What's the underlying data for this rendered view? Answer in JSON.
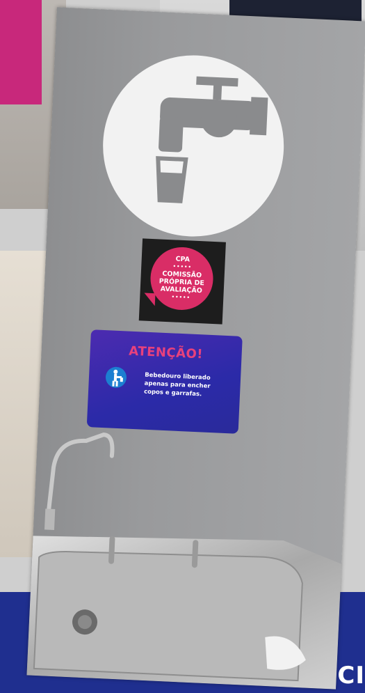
{
  "background": {
    "top_right_card_text": "",
    "bottom_band_text": "SOCI",
    "bottom_band_color": "#1f2f8f"
  },
  "sign_water": {
    "icon": "faucet-and-cup-icon",
    "circle_color": "#f2f2f2",
    "icon_color": "#8a8b8d"
  },
  "cpa_badge": {
    "line1": "CPA",
    "line2": "COMISSÃO",
    "line3": "PRÓPRIA DE",
    "line4": "AVALIAÇÃO",
    "dots": "•••••",
    "bubble_color": "#d92d66"
  },
  "notice": {
    "title": "ATENÇÃO!",
    "body": "Bebedouro liberado apenas para encher copos e garrafas.",
    "footer_left": "",
    "footer_right": "",
    "icon": "person-drinking-icon",
    "title_color": "#e8417c"
  }
}
